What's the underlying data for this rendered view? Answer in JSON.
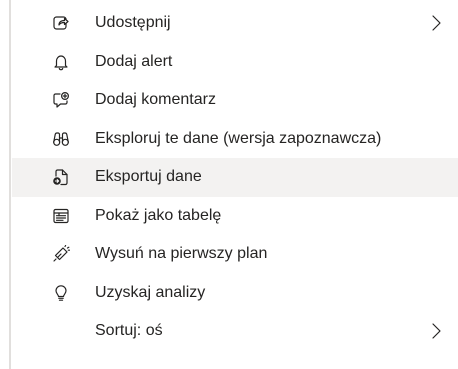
{
  "menu": {
    "items": [
      {
        "label": "Udostępnij",
        "icon": "share-icon",
        "submenu": true
      },
      {
        "label": "Dodaj alert",
        "icon": "bell-icon",
        "submenu": false
      },
      {
        "label": "Dodaj komentarz",
        "icon": "comment-add-icon",
        "submenu": false
      },
      {
        "label": "Eksploruj te dane (wersja zapoznawcza)",
        "icon": "binoculars-icon",
        "submenu": false
      },
      {
        "label": "Eksportuj dane",
        "icon": "export-document-icon",
        "submenu": false,
        "highlighted": true
      },
      {
        "label": "Pokaż jako tabelę",
        "icon": "table-view-icon",
        "submenu": false
      },
      {
        "label": "Wysuń na pierwszy plan",
        "icon": "spotlight-icon",
        "submenu": false
      },
      {
        "label": "Uzyskaj analizy",
        "icon": "lightbulb-icon",
        "submenu": false
      },
      {
        "label": "Sortuj: oś",
        "icon": "",
        "submenu": true
      }
    ]
  },
  "colors": {
    "text": "#252423",
    "highlight": "#f3f2f1",
    "border": "#e1dfdd"
  }
}
